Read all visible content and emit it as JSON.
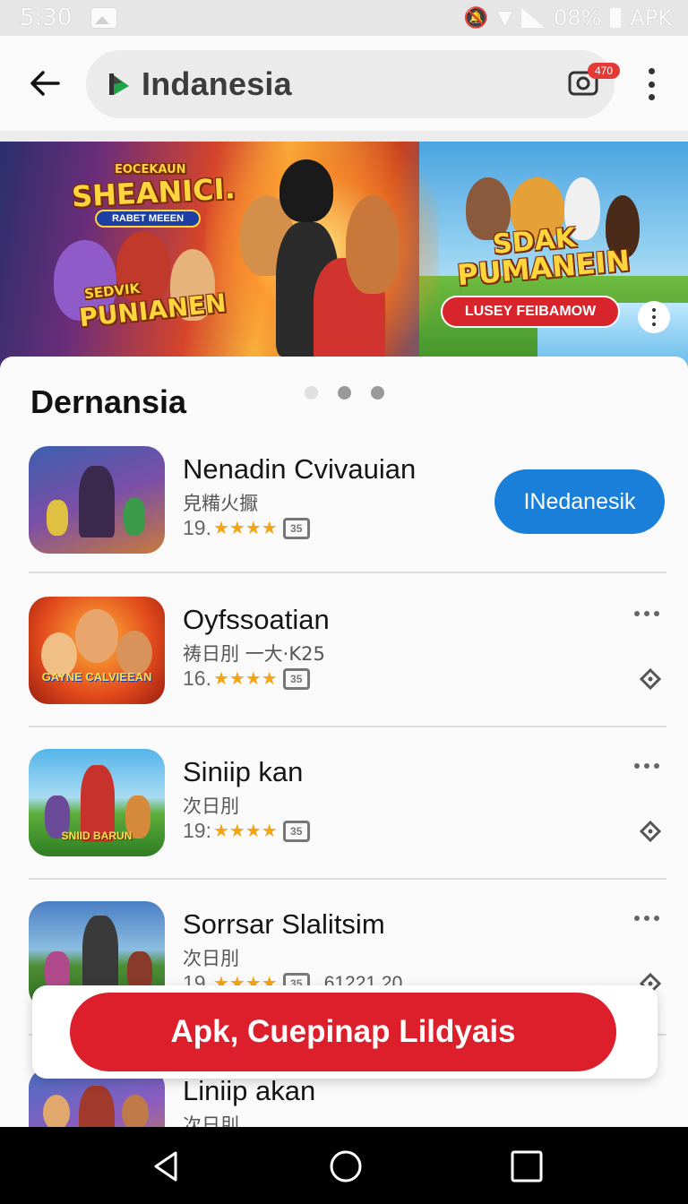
{
  "status_bar": {
    "time": "5:30",
    "battery_text": "08%",
    "carrier": "APK"
  },
  "app_bar": {
    "search_text": "Indanesia",
    "camera_badge": "470"
  },
  "banner": {
    "small_text": "EOCEKAUN",
    "headline_left": "SHEANICI.",
    "pill_text": "RABET MEEEN",
    "sub_left_small": "SEDVIK",
    "sub_left_big": "PUNIANEN",
    "headline_right_1": "SDAK",
    "headline_right_2": "PUMANEIN",
    "cta_label": "LUSEY FEIBAMOW"
  },
  "section": {
    "title": "Dernansia"
  },
  "apps": [
    {
      "name": "Nenadin Cvivauian",
      "sub": "皃糒火擫",
      "rating": "19.",
      "stars": "★★★★",
      "age": "35",
      "button": "INedanesik"
    },
    {
      "name": "Oyfssoatian",
      "sub": "祷日刖 一大·K25",
      "rating": "16.",
      "stars": "★★★★",
      "age": "35",
      "icon_text": "GAYNE CALVIEEAN"
    },
    {
      "name": "Siniip kan",
      "sub": "次日刖",
      "rating": "19:",
      "stars": "★★★★",
      "age": "35",
      "icon_text": "SNIID BARUN"
    },
    {
      "name": "Sorrsar Slalitsim",
      "sub": "次日刖",
      "rating": "19.",
      "stars": "★★★★",
      "age": "35",
      "extra": "61221.20"
    },
    {
      "name": "Liniip akan",
      "sub": "次日刖"
    }
  ],
  "cta": {
    "label": "Apk, Cuepinap Lildyais"
  },
  "colors": {
    "install_blue": "#1a7fd8",
    "cta_red": "#dd1f2b",
    "star_orange": "#f2a413"
  }
}
